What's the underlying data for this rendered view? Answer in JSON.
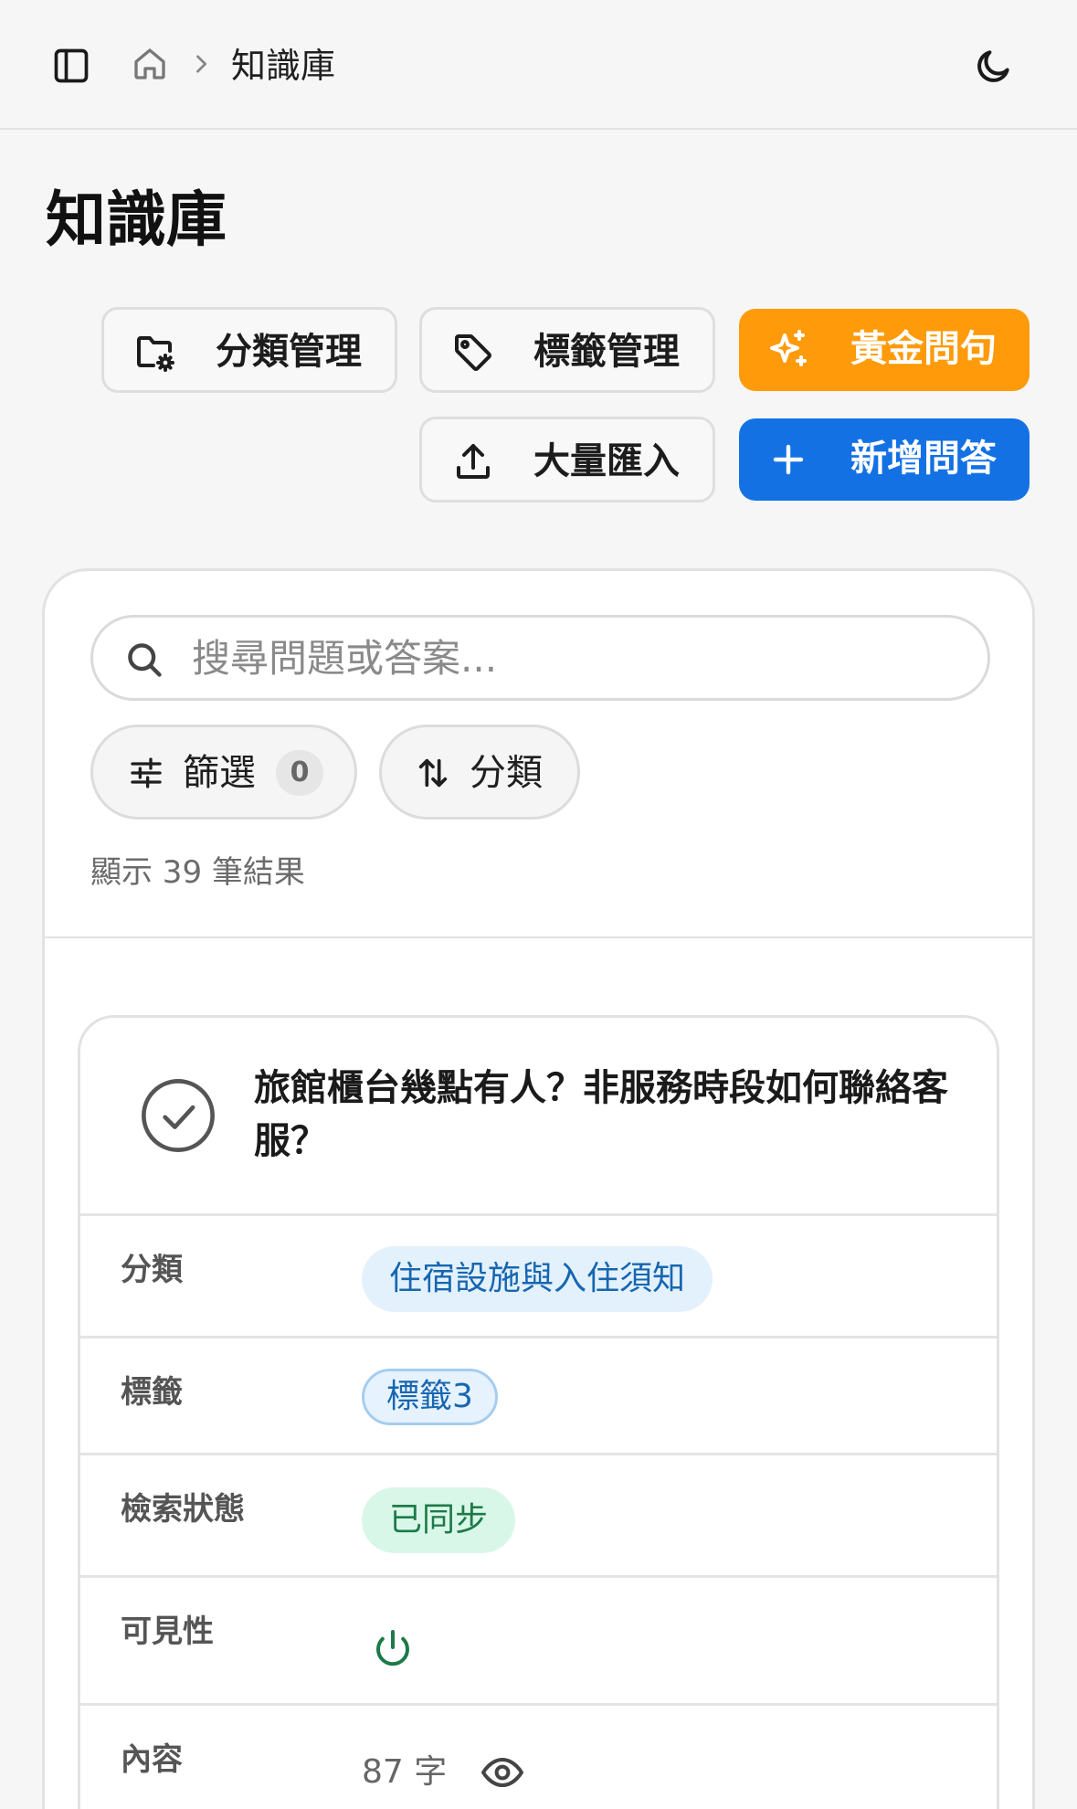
{
  "breadcrumb": {
    "current": "知識庫"
  },
  "page": {
    "title": "知識庫"
  },
  "actions": {
    "category_mgmt": "分類管理",
    "tag_mgmt": "標籤管理",
    "golden_questions": "黃金問句",
    "bulk_import": "大量匯入",
    "add_qa": "新增問答"
  },
  "search": {
    "placeholder": "搜尋問題或答案..."
  },
  "filters": {
    "filter_label": "篩選",
    "filter_count": "0",
    "sort_label": "分類"
  },
  "results": {
    "text": "顯示 39 筆結果"
  },
  "item": {
    "question": "旅館櫃台幾點有人？非服務時段如何聯絡客服？",
    "category_label": "分類",
    "category_value": "住宿設施與入住須知",
    "tags_label": "標籤",
    "tag_value": "標籤3",
    "status_label": "檢索狀態",
    "status_value": "已同步",
    "visibility_label": "可見性",
    "content_label": "內容",
    "content_length": "87 字"
  },
  "colors": {
    "orange_button": "#ff9a0a",
    "blue_button": "#1371e4",
    "synced_green": "#1d7a48",
    "tag_blue": "#1766b0"
  },
  "icons": {
    "sidebar_toggle": "sidebar-toggle-icon",
    "home": "home-icon",
    "chevron": "chevron-right-icon",
    "theme": "moon-icon",
    "folder_settings": "folder-gear-icon",
    "tag": "tag-icon",
    "sparkles": "sparkles-icon",
    "upload": "upload-icon",
    "plus": "plus-icon",
    "search": "search-icon",
    "sliders": "sliders-icon",
    "sort": "sort-arrows-icon",
    "check_circle": "check-circle-icon",
    "power": "power-icon",
    "eye": "eye-icon"
  }
}
